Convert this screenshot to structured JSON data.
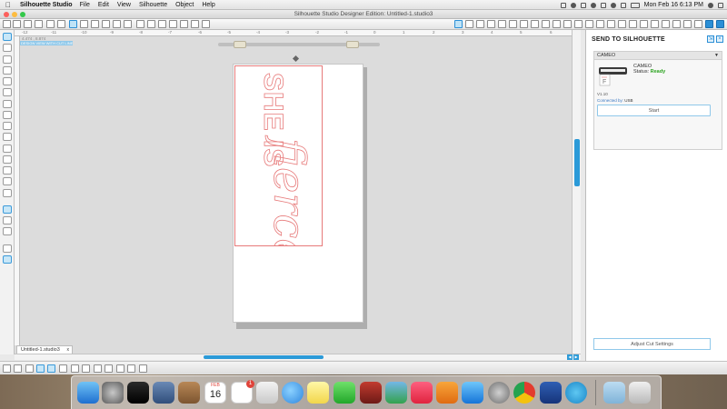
{
  "menubar": {
    "app_name": "Silhouette Studio",
    "items": [
      "File",
      "Edit",
      "View",
      "Silhouette",
      "Object",
      "Help"
    ],
    "clock": "Mon Feb 16  6:13 PM"
  },
  "window": {
    "title": "Silhouette Studio Designer Edition: Untitled-1.studio3"
  },
  "canvas": {
    "coordinate_readout": "4.474 , 8.874",
    "hint_label": "DESIGN VIEW WITH CUT LINES",
    "ruler_labels": [
      "-12",
      "-11",
      "-10",
      "-9",
      "-8",
      "-7",
      "-6",
      "-5",
      "-4",
      "-3",
      "-2",
      "-1",
      "0",
      "1",
      "2",
      "3",
      "4",
      "5",
      "6"
    ],
    "artwork_text_block": "SHE IS",
    "artwork_text_script": "fierce",
    "line_color": "#e77a7a"
  },
  "document_tab": {
    "label": "Untitled-1.studio3",
    "close": "x"
  },
  "send_panel": {
    "title": "SEND TO SILHOUETTE",
    "device_header": "CAMEO",
    "device_name": "CAMEO",
    "status_label": "Status:",
    "status_value": "Ready",
    "version": "V1.10",
    "connected_label": "Connected by:",
    "connected_value": "USB",
    "start_button": "Start",
    "adjust_button": "Adjust Cut Settings",
    "accent_color": "#2b8fd6",
    "status_color": "#2aa31e"
  },
  "dock": {
    "calendar_month": "FEB",
    "calendar_day": "16",
    "reminders_badge": "1"
  }
}
